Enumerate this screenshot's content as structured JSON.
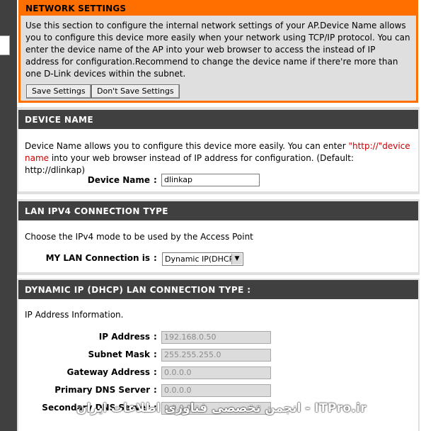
{
  "network_settings": {
    "title": "NETWORK SETTINGS",
    "description": "Use this section to configure the internal network settings of your AP.Device Name allows you to configure this device more easily when your network using TCP/IP protocol. You can enter the device name of the AP into your web browser to access the instead of IP address for configuration.Recommend to change the device name if there're more than one D-Link devices within the subnet.",
    "save_label": "Save Settings",
    "dont_save_label": "Don't Save Settings"
  },
  "device_name": {
    "title": "DEVICE NAME",
    "desc_part1": "Device Name allows you to configure this device more easily. You can enter ",
    "desc_red": "\"http://\"device name",
    "desc_part2": " into your web browser instead of IP address for configuration. (Default: http://dlinkap)",
    "label": "Device Name",
    "colon": ":",
    "value": "dlinkap"
  },
  "lan_ipv4": {
    "title": "LAN IPV4 CONNECTION TYPE",
    "desc": "Choose the IPv4 mode to be used by the Access Point",
    "label": "MY LAN Connection is",
    "colon": ":",
    "selected": "Dynamic IP(DHCP)"
  },
  "dhcp": {
    "title": "DYNAMIC IP (DHCP) LAN CONNECTION TYPE :",
    "info": "IP Address Information.",
    "fields": [
      {
        "label": "IP Address",
        "value": "192.168.0.50"
      },
      {
        "label": "Subnet Mask",
        "value": "255.255.255.0"
      },
      {
        "label": "Gateway Address",
        "value": "0.0.0.0"
      },
      {
        "label": "Primary DNS Server",
        "value": "0.0.0.0"
      },
      {
        "label": "Secondary DNS Server",
        "value": "0.0.0.0"
      }
    ],
    "colon": ":"
  },
  "watermark": "انجمن تخصصی فناوری اطلاعات ایران - ITPro.ir"
}
